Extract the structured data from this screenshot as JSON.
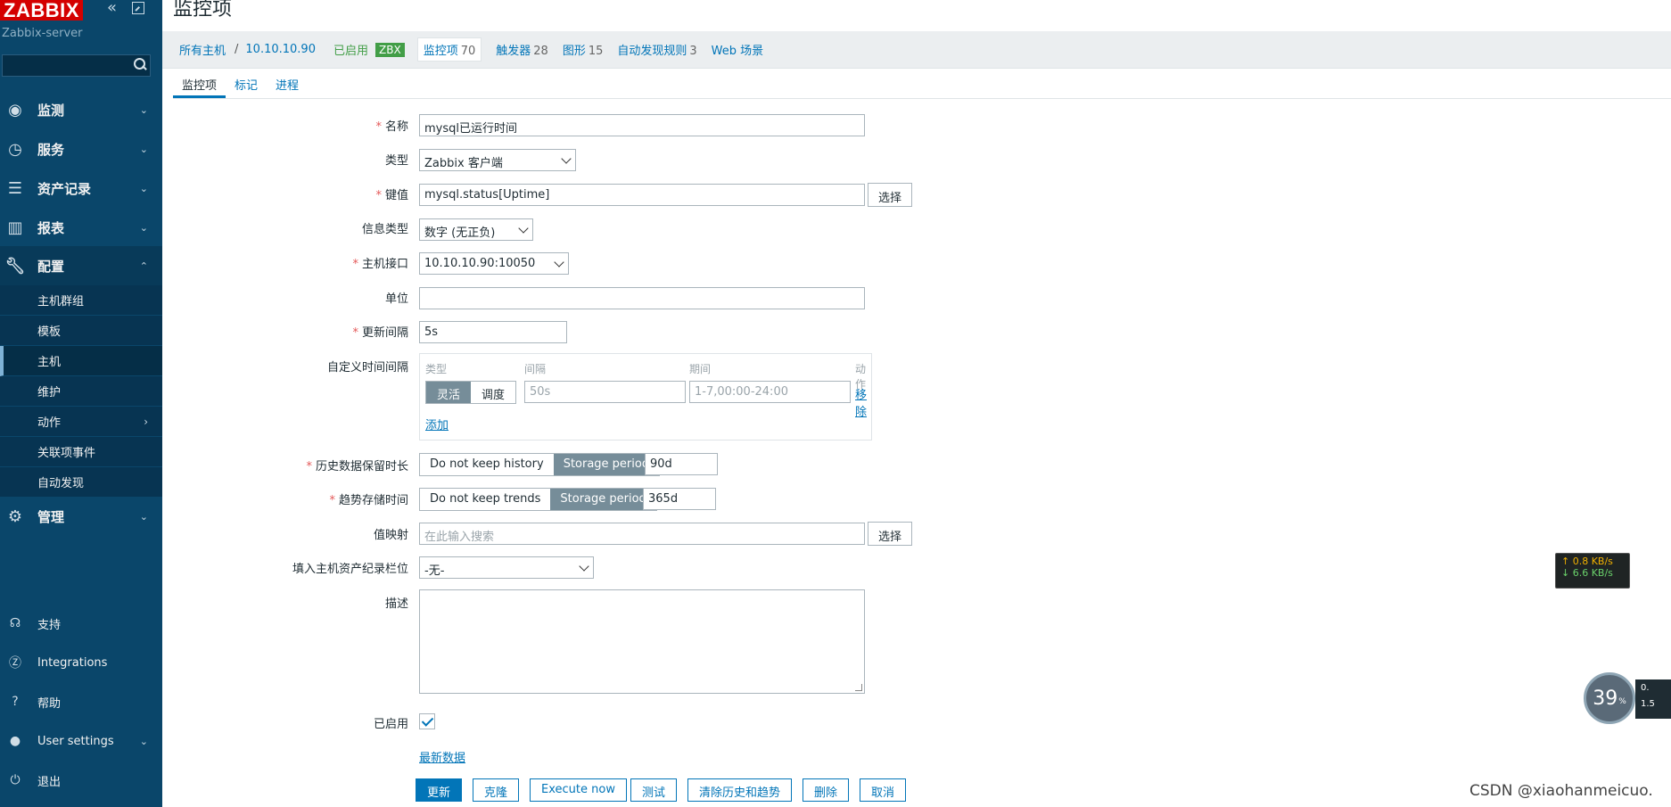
{
  "sidebar": {
    "logo": "ZABBIX",
    "server_name": "Zabbix-server",
    "menu": [
      {
        "label": "监测"
      },
      {
        "label": "服务"
      },
      {
        "label": "资产记录"
      },
      {
        "label": "报表"
      },
      {
        "label": "配置"
      },
      {
        "label": "管理"
      }
    ],
    "config_submenu": [
      {
        "label": "主机群组"
      },
      {
        "label": "模板"
      },
      {
        "label": "主机"
      },
      {
        "label": "维护"
      },
      {
        "label": "动作"
      },
      {
        "label": "关联项事件"
      },
      {
        "label": "自动发现"
      }
    ],
    "bottom": [
      {
        "label": "支持"
      },
      {
        "label": "Integrations"
      },
      {
        "label": "帮助"
      },
      {
        "label": "User settings"
      },
      {
        "label": "退出"
      }
    ]
  },
  "page": {
    "title": "监控项"
  },
  "breadcrumb": {
    "all_hosts": "所有主机",
    "host": "10.10.10.90",
    "enabled": "已启用",
    "zbx": "ZBX",
    "items": {
      "label": "监控项",
      "count": "70"
    },
    "triggers": {
      "label": "触发器",
      "count": "28"
    },
    "graphs": {
      "label": "图形",
      "count": "15"
    },
    "discovery": {
      "label": "自动发现规则",
      "count": "3"
    },
    "web": "Web 场景"
  },
  "tabs": [
    "监控项",
    "标记",
    "进程"
  ],
  "form": {
    "name": {
      "label": "名称",
      "value": "mysql已运行时间"
    },
    "type": {
      "label": "类型",
      "value": "Zabbix 客户端"
    },
    "key": {
      "label": "键值",
      "value": "mysql.status[Uptime]",
      "select": "选择"
    },
    "info_type": {
      "label": "信息类型",
      "value": "数字 (无正负)"
    },
    "interface": {
      "label": "主机接口",
      "value": "10.10.10.90:10050"
    },
    "units": {
      "label": "单位",
      "value": ""
    },
    "interval": {
      "label": "更新间隔",
      "value": "5s"
    },
    "custom_intervals": {
      "label": "自定义时间间隔",
      "headers": {
        "type": "类型",
        "interval": "间隔",
        "period": "期间",
        "action": "动作"
      },
      "flexible": "灵活",
      "scheduling": "调度",
      "interval_placeholder": "50s",
      "period_placeholder": "1-7,00:00-24:00",
      "remove": "移除",
      "add": "添加"
    },
    "history": {
      "label": "历史数据保留时长",
      "no_keep": "Do not keep history",
      "storage": "Storage period",
      "value": "90d"
    },
    "trends": {
      "label": "趋势存储时间",
      "no_keep": "Do not keep trends",
      "storage": "Storage period",
      "value": "365d"
    },
    "valuemap": {
      "label": "值映射",
      "placeholder": "在此输入搜索",
      "select": "选择"
    },
    "inventory": {
      "label": "填入主机资产纪录栏位",
      "value": "-无-"
    },
    "description": {
      "label": "描述"
    },
    "enabled": {
      "label": "已启用"
    },
    "latest_data": "最新数据"
  },
  "actions": {
    "update": "更新",
    "clone": "克隆",
    "execute": "Execute now",
    "test": "测试",
    "clear": "清除历史和趋势",
    "delete": "删除",
    "cancel": "取消"
  },
  "overlay": {
    "net_up": "↑ 0.8 KB/s",
    "net_down": "↓ 6.6 KB/s",
    "gauge_value": "39",
    "gauge_unit": "%",
    "side_top": "0.",
    "side_bottom": "1.5",
    "watermark": "CSDN @xiaohanmeicuo."
  },
  "colors": {
    "sidebar_bg": "#0a466a",
    "accent": "#0275b8",
    "logo_red": "#d40000",
    "enabled_green": "#429e47"
  }
}
